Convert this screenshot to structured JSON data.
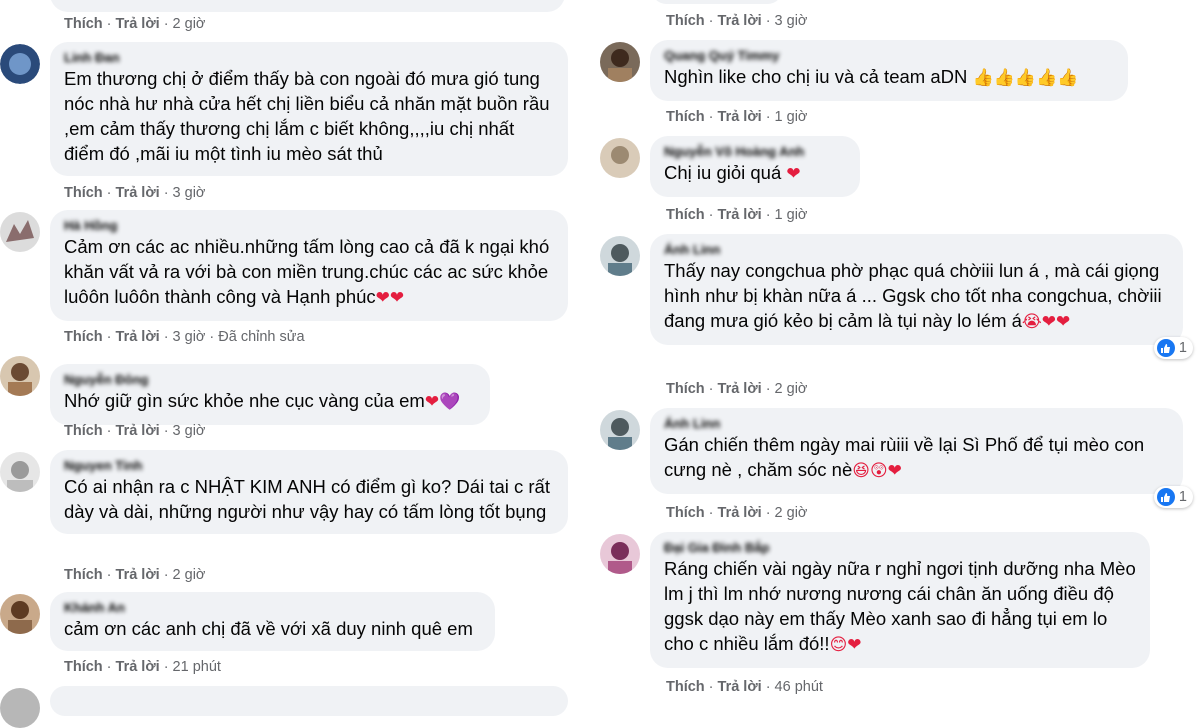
{
  "action_like": "Thích",
  "action_reply": "Trả lời",
  "separator": "·",
  "colors": {
    "bubble": "#f0f2f5",
    "like_blue": "#1877f2",
    "heart": "#e41e3f",
    "purple_heart": "#8a2be2"
  },
  "left_column": {
    "top_meta": {
      "time": "2 giờ"
    },
    "comments": [
      {
        "author": "Linh Đan",
        "text": "Em thương chị ở điểm thấy bà con ngoài đó mưa gió tung nóc nhà hư nhà cửa hết chị liền biểu cả nhăn mặt buồn rầu ,em cảm thấy thương chị lắm c biết không,,,,iu chị nhất điểm đó ,mãi iu một tình iu mèo sát thủ",
        "time": "3 giờ",
        "edited": "",
        "emoji": ""
      },
      {
        "author": "Hà Hồng",
        "text": "Cảm ơn các ac nhiều.những tấm lòng cao cả đã k ngại khó khăn vất vả ra với bà con miền trung.chúc các ac sức khỏe luôôn luôôn thành công và Hạnh phúc",
        "time": "3 giờ",
        "edited": "Đã chỉnh sửa",
        "emoji": "❤❤"
      },
      {
        "author": "Nguyễn Đông",
        "text": "Nhớ giữ gìn sức khỏe nhe cục vàng của em",
        "time": "3 giờ",
        "edited": "",
        "emoji": "❤💜"
      },
      {
        "author": "Nguyen Tinh",
        "text": "Có ai nhận ra c NHẬT KIM ANH có điểm gì ko? Dái tai c rất dày và dài, những người như vậy hay có tấm lòng tốt bụng",
        "time": "2 giờ",
        "edited": "",
        "emoji": ""
      },
      {
        "author": "Khánh An",
        "text": "cảm ơn các anh chị đã về với xã duy ninh quê em",
        "time": "21 phút",
        "edited": "",
        "emoji": ""
      }
    ]
  },
  "right_column": {
    "top_meta": {
      "time": "3 giờ"
    },
    "comments": [
      {
        "author": "Quang Quý Timmy",
        "text": "Nghìn like cho chị iu và cả team aDN",
        "time": "1 giờ",
        "emoji": "👍👍👍👍👍",
        "reactions": ""
      },
      {
        "author": "Nguyễn Võ Hoàng Anh",
        "text": "Chị iu giỏi quá",
        "time": "1 giờ",
        "emoji": "❤",
        "reactions": ""
      },
      {
        "author": "Ánh Linn",
        "text": "Thấy nay congchua phờ phạc quá chờiii lun á , mà cái giọng hình như bị khàn nữa á ... Ggsk cho tốt nha congchua, chờiii đang mưa gió kẻo bị cảm là tụi này lo lém á",
        "time": "2 giờ",
        "emoji": "😭❤❤",
        "reactions": "1"
      },
      {
        "author": "Ánh Linn",
        "text": "Gán chiến thêm ngày mai rùiii về lại Sì Phố để tụi mèo con cưng nè , chăm sóc nè",
        "time": "2 giờ",
        "emoji": "😆😲❤",
        "reactions": "1"
      },
      {
        "author": "Đại Gia Đình Bắp",
        "text": "Ráng chiến vài ngày nữa r nghỉ ngơi tịnh dưỡng nha Mèo lm j thì lm nhớ nương nương cái chân ăn uống điều độ ggsk dạo này em thấy Mèo xanh sao đi hẳng tụi em lo cho c nhiều lắm đó!!",
        "time": "46 phút",
        "emoji": "😊❤",
        "reactions": ""
      }
    ]
  }
}
